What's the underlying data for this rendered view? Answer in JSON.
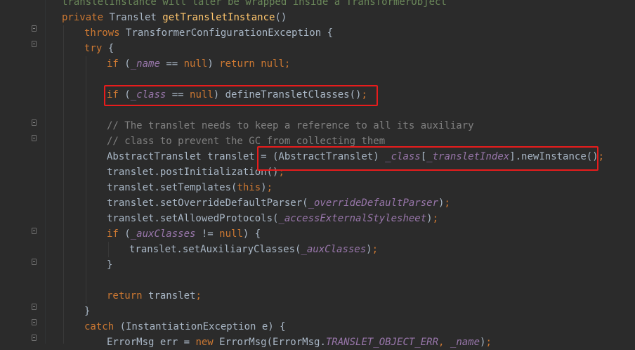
{
  "editor": {
    "accent_color": "#e81c1c",
    "background": "#2b2b2b",
    "lines": [
      {
        "indent": 0,
        "tokens": [
          {
            "t": "transletInstance will later be wrapped inside a TransformerObject",
            "c": "partial"
          }
        ]
      },
      {
        "indent": 0,
        "tokens": [
          {
            "t": "private ",
            "c": "kw"
          },
          {
            "t": "Translet ",
            "c": "plain"
          },
          {
            "t": "getTransletInstance",
            "c": "fn"
          },
          {
            "t": "()",
            "c": "plain"
          }
        ]
      },
      {
        "indent": 1,
        "tokens": [
          {
            "t": "throws ",
            "c": "kw"
          },
          {
            "t": "TransformerConfigurationException {",
            "c": "plain"
          }
        ]
      },
      {
        "indent": 1,
        "tokens": [
          {
            "t": "try ",
            "c": "kw"
          },
          {
            "t": "{",
            "c": "plain"
          }
        ]
      },
      {
        "indent": 2,
        "tokens": [
          {
            "t": "if ",
            "c": "kw"
          },
          {
            "t": "(",
            "c": "plain"
          },
          {
            "t": "_name",
            "c": "field"
          },
          {
            "t": " == ",
            "c": "plain"
          },
          {
            "t": "null",
            "c": "kw"
          },
          {
            "t": ") ",
            "c": "plain"
          },
          {
            "t": "return null",
            "c": "kw"
          },
          {
            "t": ";",
            "c": "kw"
          }
        ]
      },
      {
        "indent": 2,
        "tokens": []
      },
      {
        "indent": 2,
        "tokens": [
          {
            "t": "if ",
            "c": "kw"
          },
          {
            "t": "(",
            "c": "plain"
          },
          {
            "t": "_class",
            "c": "field"
          },
          {
            "t": " == ",
            "c": "plain"
          },
          {
            "t": "null",
            "c": "kw"
          },
          {
            "t": ") defineTransletClasses()",
            "c": "plain"
          },
          {
            "t": ";",
            "c": "kw"
          }
        ]
      },
      {
        "indent": 2,
        "tokens": []
      },
      {
        "indent": 2,
        "tokens": [
          {
            "t": "// The translet needs to keep a reference to all its auxiliary",
            "c": "comment"
          }
        ]
      },
      {
        "indent": 2,
        "tokens": [
          {
            "t": "// class to prevent the GC from collecting them",
            "c": "comment"
          }
        ]
      },
      {
        "indent": 2,
        "tokens": [
          {
            "t": "AbstractTranslet translet = (AbstractTranslet) ",
            "c": "plain"
          },
          {
            "t": "_class",
            "c": "field"
          },
          {
            "t": "[",
            "c": "plain"
          },
          {
            "t": "_transletIndex",
            "c": "field"
          },
          {
            "t": "].newInstance()",
            "c": "plain"
          },
          {
            "t": ";",
            "c": "kw"
          }
        ]
      },
      {
        "indent": 2,
        "tokens": [
          {
            "t": "translet.postInitialization()",
            "c": "plain"
          },
          {
            "t": ";",
            "c": "kw"
          }
        ]
      },
      {
        "indent": 2,
        "tokens": [
          {
            "t": "translet.setTemplates(",
            "c": "plain"
          },
          {
            "t": "this",
            "c": "kw"
          },
          {
            "t": ")",
            "c": "plain"
          },
          {
            "t": ";",
            "c": "kw"
          }
        ]
      },
      {
        "indent": 2,
        "tokens": [
          {
            "t": "translet.setOverrideDefaultParser(",
            "c": "plain"
          },
          {
            "t": "_overrideDefaultParser",
            "c": "field"
          },
          {
            "t": ")",
            "c": "plain"
          },
          {
            "t": ";",
            "c": "kw"
          }
        ]
      },
      {
        "indent": 2,
        "tokens": [
          {
            "t": "translet.setAllowedProtocols(",
            "c": "plain"
          },
          {
            "t": "_accessExternalStylesheet",
            "c": "field"
          },
          {
            "t": ")",
            "c": "plain"
          },
          {
            "t": ";",
            "c": "kw"
          }
        ]
      },
      {
        "indent": 2,
        "tokens": [
          {
            "t": "if ",
            "c": "kw"
          },
          {
            "t": "(",
            "c": "plain"
          },
          {
            "t": "_auxClasses",
            "c": "field"
          },
          {
            "t": " != ",
            "c": "plain"
          },
          {
            "t": "null",
            "c": "kw"
          },
          {
            "t": ") {",
            "c": "plain"
          }
        ]
      },
      {
        "indent": 3,
        "tokens": [
          {
            "t": "translet.setAuxiliaryClasses(",
            "c": "plain"
          },
          {
            "t": "_auxClasses",
            "c": "field"
          },
          {
            "t": ")",
            "c": "plain"
          },
          {
            "t": ";",
            "c": "kw"
          }
        ]
      },
      {
        "indent": 2,
        "tokens": [
          {
            "t": "}",
            "c": "plain"
          }
        ]
      },
      {
        "indent": 2,
        "tokens": []
      },
      {
        "indent": 2,
        "tokens": [
          {
            "t": "return ",
            "c": "kw"
          },
          {
            "t": "translet",
            "c": "plain"
          },
          {
            "t": ";",
            "c": "kw"
          }
        ]
      },
      {
        "indent": 1,
        "tokens": [
          {
            "t": "}",
            "c": "plain"
          }
        ]
      },
      {
        "indent": 1,
        "tokens": [
          {
            "t": "catch ",
            "c": "kw"
          },
          {
            "t": "(InstantiationException e) {",
            "c": "plain"
          }
        ]
      },
      {
        "indent": 2,
        "tokens": [
          {
            "t": "ErrorMsg err = ",
            "c": "plain"
          },
          {
            "t": "new ",
            "c": "kw"
          },
          {
            "t": "ErrorMsg(ErrorMsg.",
            "c": "plain"
          },
          {
            "t": "TRANSLET_OBJECT_ERR",
            "c": "const"
          },
          {
            "t": ", ",
            "c": "kw"
          },
          {
            "t": "_name",
            "c": "field"
          },
          {
            "t": ")",
            "c": "plain"
          },
          {
            "t": ";",
            "c": "kw"
          }
        ]
      }
    ]
  }
}
